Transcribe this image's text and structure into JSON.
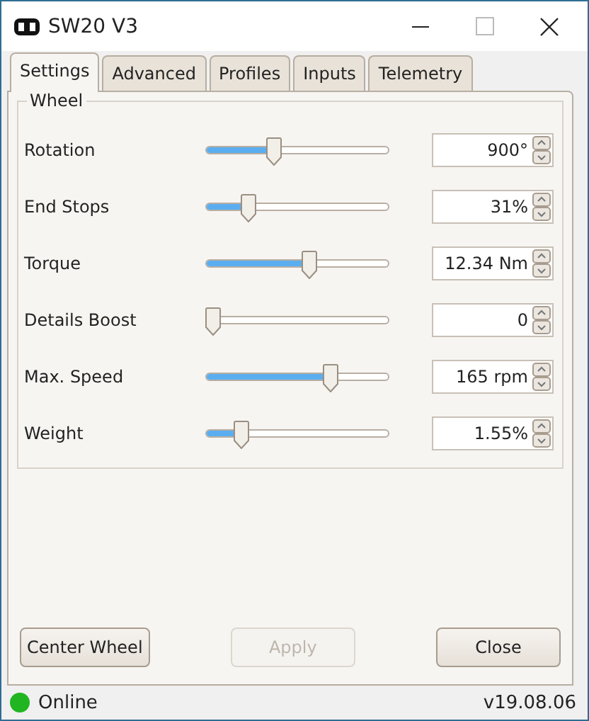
{
  "window": {
    "title": "SW20 V3"
  },
  "tabs": [
    {
      "label": "Settings",
      "selected": true
    },
    {
      "label": "Advanced",
      "selected": false
    },
    {
      "label": "Profiles",
      "selected": false
    },
    {
      "label": "Inputs",
      "selected": false
    },
    {
      "label": "Telemetry",
      "selected": false
    }
  ],
  "group": {
    "title": "Wheel"
  },
  "settings": [
    {
      "name": "Rotation",
      "level": 0.36,
      "value": "900°"
    },
    {
      "name": "End Stops",
      "level": 0.21,
      "value": "31%"
    },
    {
      "name": "Torque",
      "level": 0.57,
      "value": "12.34 Nm"
    },
    {
      "name": "Details Boost",
      "level": 0,
      "value": "0"
    },
    {
      "name": "Max. Speed",
      "level": 0.7,
      "value": "165 rpm"
    },
    {
      "name": "Weight",
      "level": 0.17,
      "value": "1.55%"
    }
  ],
  "buttons": [
    {
      "label": "Center Wheel",
      "disabled": false
    },
    {
      "label": "Apply",
      "disabled": true
    },
    {
      "label": "Close",
      "disabled": false
    }
  ],
  "status_bar": {
    "status": "Online",
    "online": true,
    "version": "v19.08.06"
  }
}
